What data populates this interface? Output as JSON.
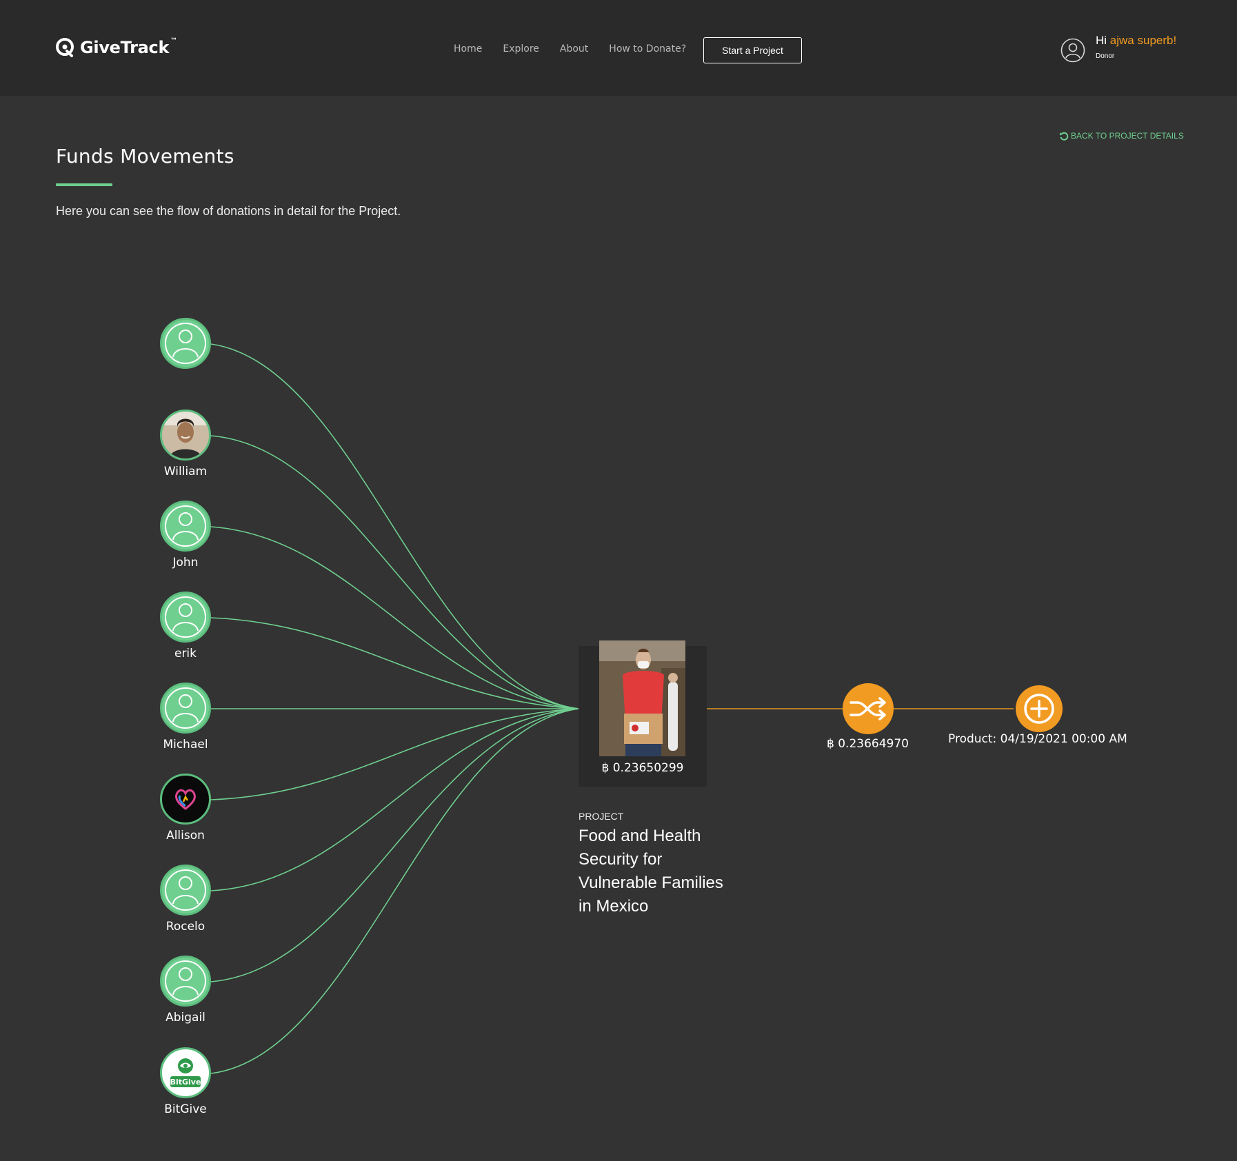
{
  "brand": {
    "name": "GiveTrack",
    "tm": "™"
  },
  "nav": {
    "home": "Home",
    "explore": "Explore",
    "about": "About",
    "how_to_donate": "How to Donate?",
    "start_project": "Start a Project"
  },
  "user": {
    "greeting": "Hi",
    "name": "ajwa superb",
    "exclaim": "!",
    "role": "Donor"
  },
  "back_link": "BACK TO PROJECT DETAILS",
  "page": {
    "title": "Funds Movements",
    "subtitle": "Here you can see the flow of donations in detail for the Project."
  },
  "donors": [
    {
      "name": "",
      "avatar": "default-user-icon"
    },
    {
      "name": "William",
      "avatar": "photo"
    },
    {
      "name": "John",
      "avatar": "default-user-icon"
    },
    {
      "name": "erik",
      "avatar": "default-user-icon"
    },
    {
      "name": "Michael",
      "avatar": "default-user-icon"
    },
    {
      "name": "Allison",
      "avatar": "heart-logo"
    },
    {
      "name": "Rocelo",
      "avatar": "default-user-icon"
    },
    {
      "name": "Abigail",
      "avatar": "default-user-icon"
    },
    {
      "name": "BitGive",
      "avatar": "bitgive-logo",
      "logo_text": "BitGive"
    }
  ],
  "project": {
    "amount": "฿ 0.23650299",
    "label": "PROJECT",
    "name": "Food and Health Security for Vulnerable Families in Mexico"
  },
  "transfer_node": {
    "amount": "฿ 0.23664970",
    "icon": "shuffle-icon"
  },
  "product_node": {
    "label": "Product: 04/19/2021 00:00 AM",
    "icon": "plus-circle-icon"
  },
  "colors": {
    "accent_green": "#6fcf8f",
    "accent_orange": "#f29b22",
    "background": "#333333",
    "header": "#2a2a2a"
  }
}
